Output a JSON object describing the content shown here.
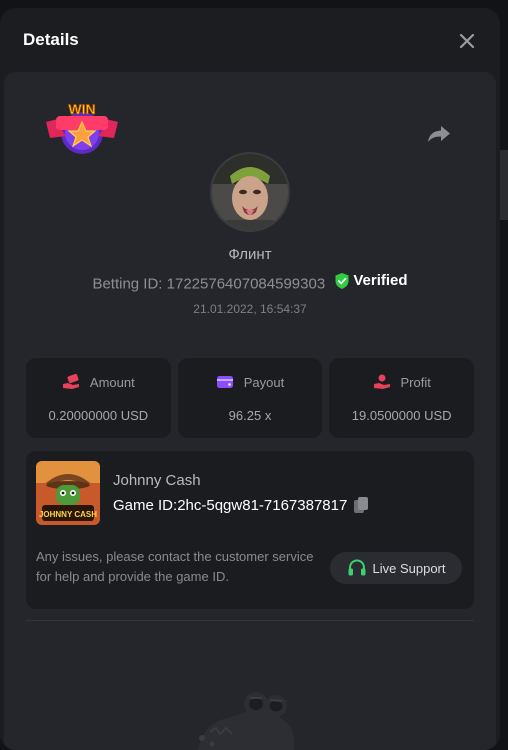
{
  "modal": {
    "title": "Details"
  },
  "bet": {
    "username": "Флинт",
    "betting_id_label": "Betting ID:",
    "betting_id": "1722576407084599303",
    "verified_label": "Verified",
    "date": "21.01.2022, 16:54:37",
    "win_badge": "WIN"
  },
  "stats": [
    {
      "label": "Amount",
      "value": "0.20000000 USD",
      "icon": "hand-money-icon",
      "color": "#e8425a"
    },
    {
      "label": "Payout",
      "value": "96.25 x",
      "icon": "wallet-icon",
      "color": "#8a4dff"
    },
    {
      "label": "Profit",
      "value": "19.0500000 USD",
      "icon": "hand-coin-icon",
      "color": "#e8425a"
    }
  ],
  "game": {
    "name": "Johnny Cash",
    "id_label": "Game ID:",
    "id": "2hc-5qgw81-7167387817",
    "thumb_caption": "JOHNNY CASH"
  },
  "support": {
    "text": "Any issues, please contact the customer service for help and provide the game ID.",
    "button_label": "Live Support"
  },
  "colors": {
    "verified_green": "#2ecc40",
    "support_green": "#3bd16f"
  }
}
